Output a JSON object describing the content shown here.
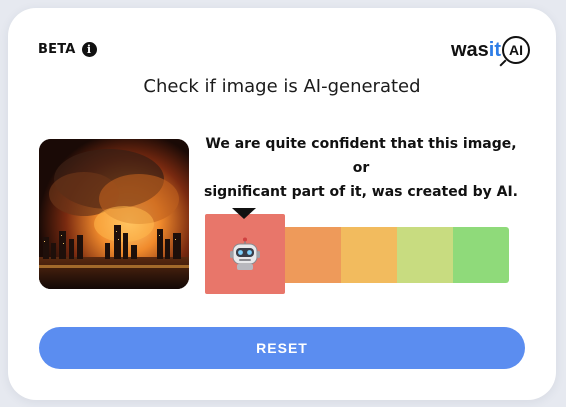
{
  "header": {
    "beta_label": "BETA",
    "info_icon": "info-icon"
  },
  "logo": {
    "was": "was",
    "it": "it",
    "ai": "AI",
    "icon": "magnifier-logo-icon"
  },
  "title": "Check if image is AI-generated",
  "image": {
    "subject": "city-fire-image"
  },
  "result": {
    "verdict_line1": "We are quite confident that this image, or",
    "verdict_line2": "significant part of it, was created by AI."
  },
  "meter": {
    "active_level": 1,
    "levels": 5,
    "indicator_icon": "robot-icon",
    "colors": [
      "#e8766a",
      "#ee9a5a",
      "#f2bb5e",
      "#c8dc80",
      "#8fda7a"
    ]
  },
  "actions": {
    "reset_label": "RESET"
  },
  "colors": {
    "accent": "#5b8df0",
    "logo_it": "#2e7de6"
  }
}
